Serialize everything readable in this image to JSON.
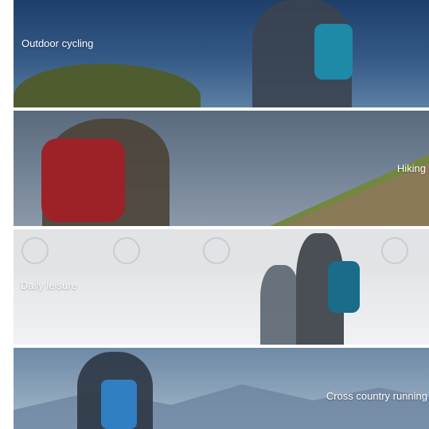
{
  "panels": [
    {
      "caption": "Outdoor cycling"
    },
    {
      "caption": "Hiking"
    },
    {
      "caption": "Daily leisure"
    },
    {
      "caption": "Cross country running"
    }
  ]
}
